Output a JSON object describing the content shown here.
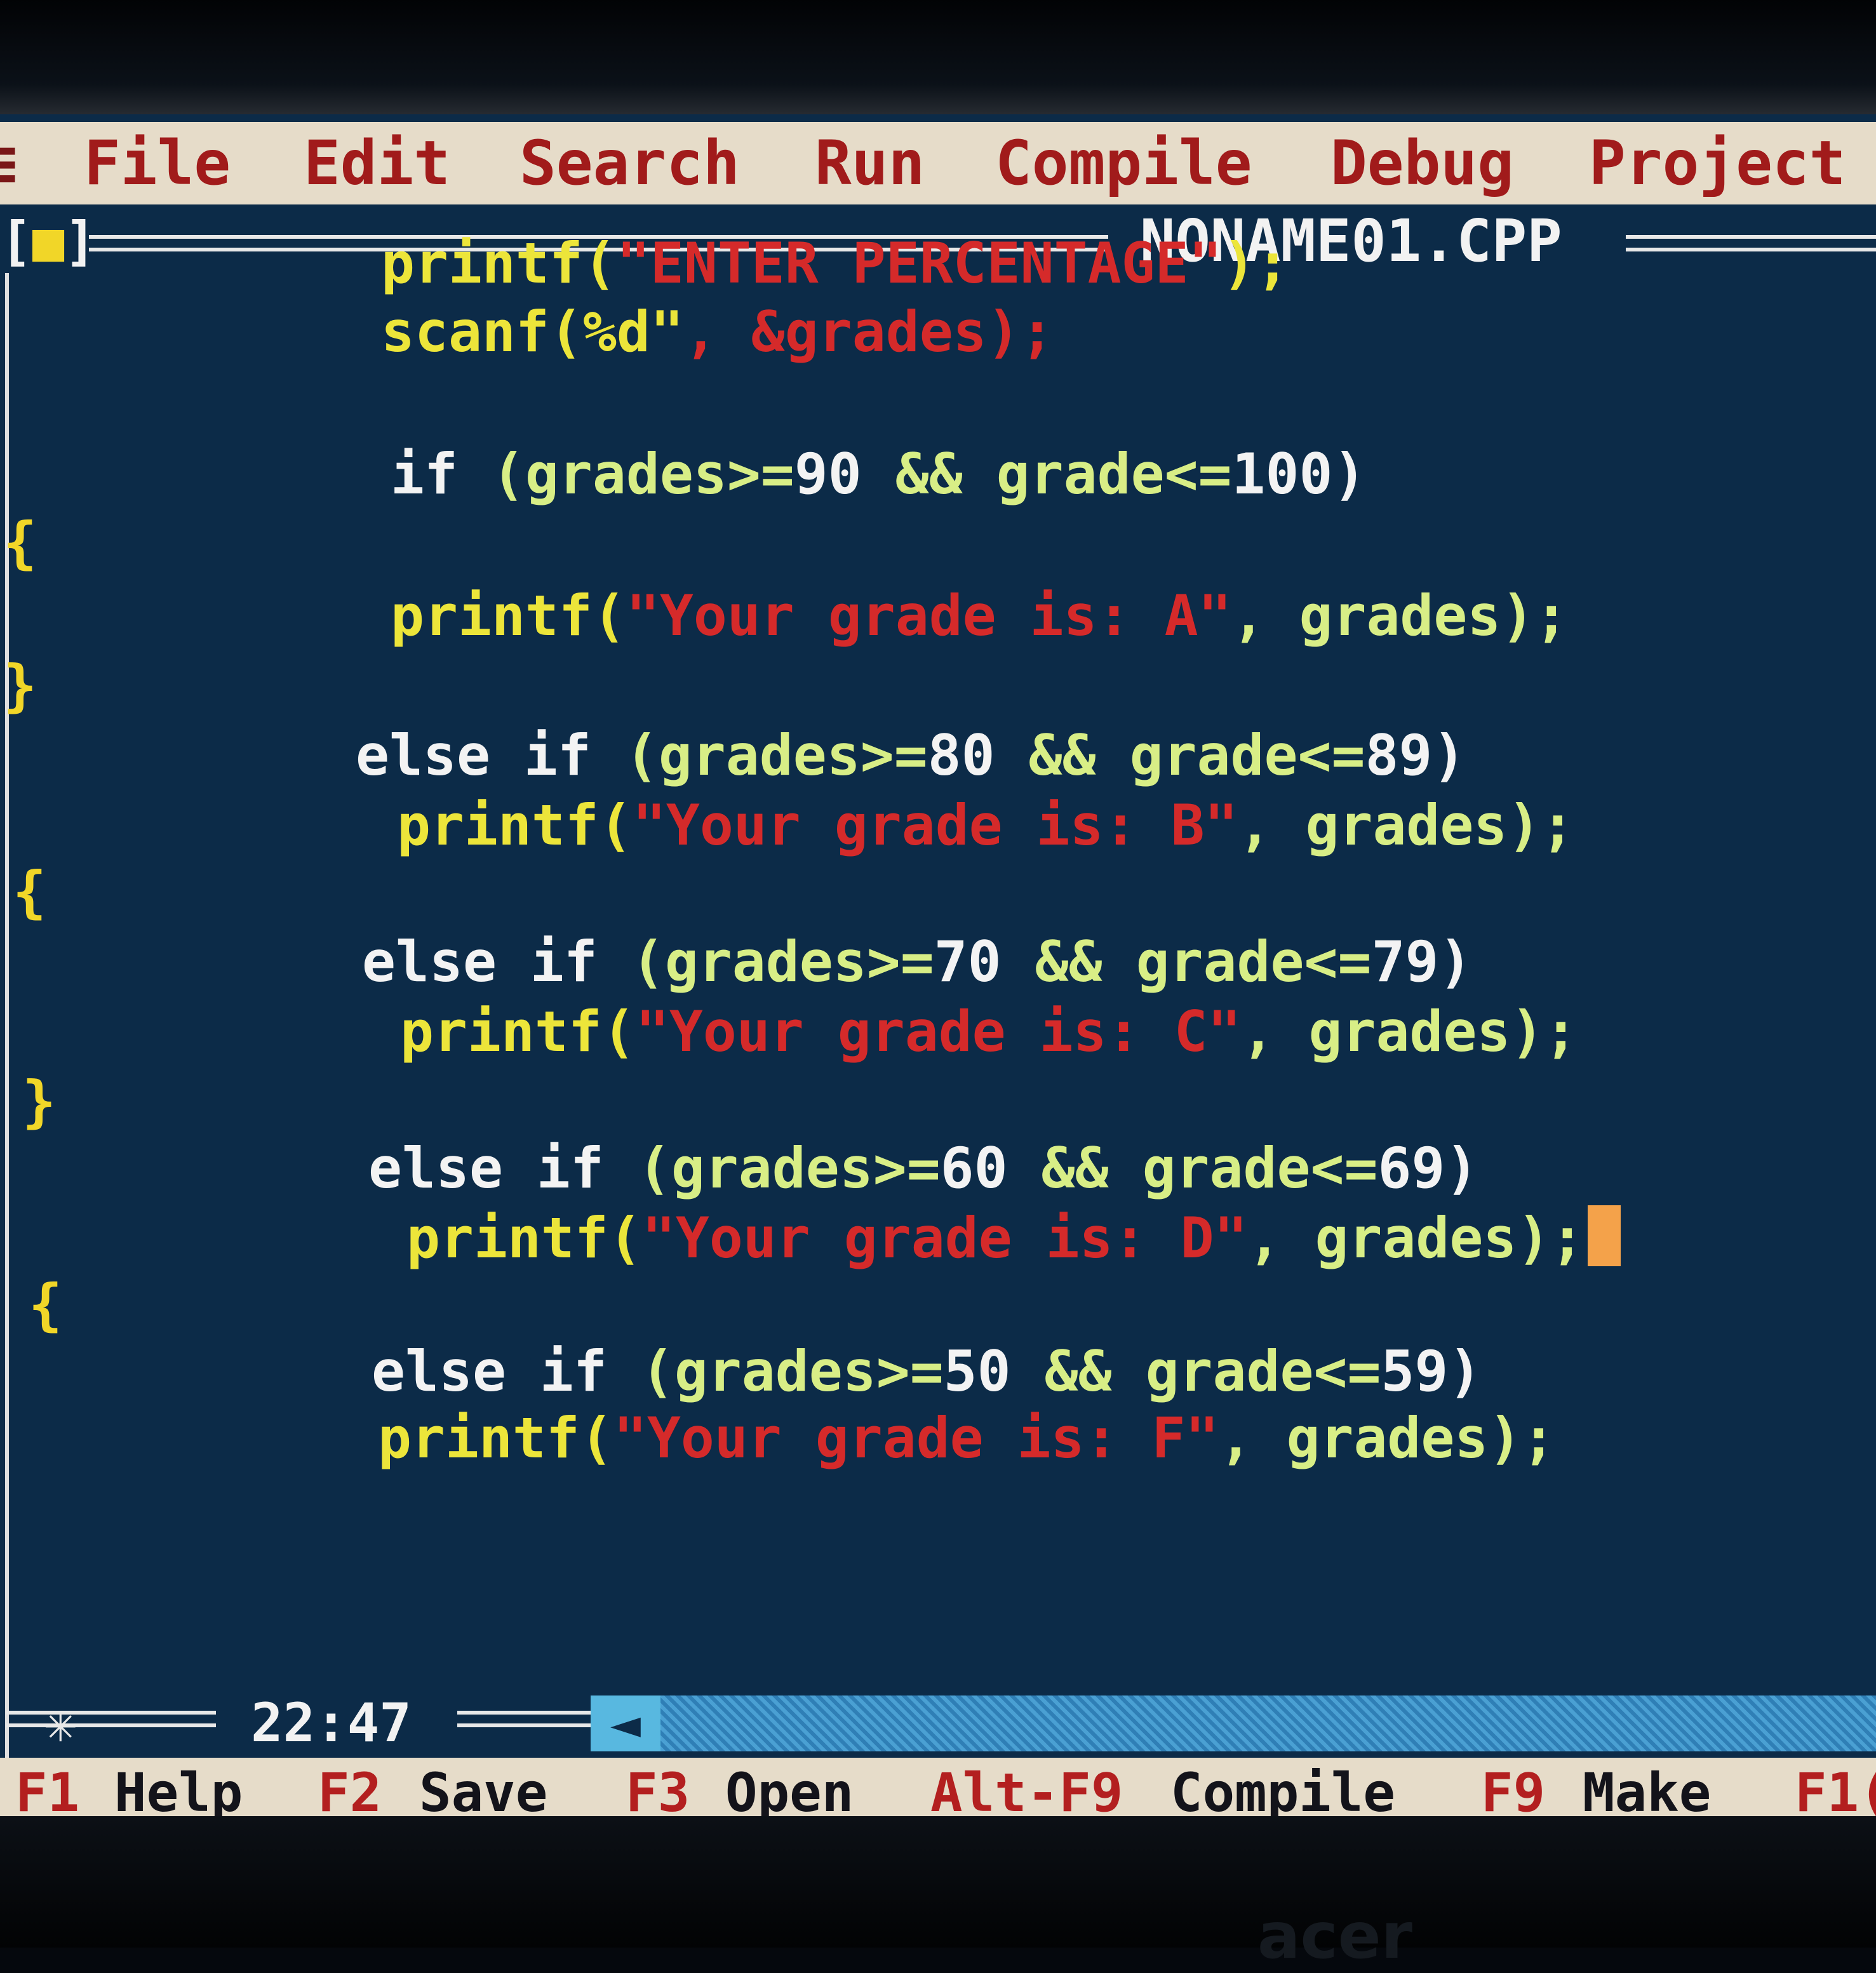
{
  "menu": {
    "system": "≡",
    "file": "File",
    "edit": "Edit",
    "search": "Search",
    "run": "Run",
    "compile": "Compile",
    "debug": "Debug",
    "project": "Project"
  },
  "window": {
    "close_box": "[■]",
    "title": "NONAME01.CPP"
  },
  "code": [
    [
      {
        "t": "printf(",
        "c": "fn"
      },
      {
        "t": "\"ENTER PERCENTAGE\"",
        "c": "st"
      },
      {
        "t": ");",
        "c": "fn"
      }
    ],
    [
      {
        "t": "scanf(%d\"",
        "c": "fn"
      },
      {
        "t": ", &grades);",
        "c": "st"
      }
    ],
    [
      {
        "t": "if ",
        "c": "kw"
      },
      {
        "t": "(grades>=",
        "c": "gr"
      },
      {
        "t": "90 ",
        "c": "kw"
      },
      {
        "t": "&& grade<=",
        "c": "gr"
      },
      {
        "t": "100)",
        "c": "kw"
      }
    ],
    [
      {
        "t": "{",
        "c": "br"
      }
    ],
    [
      {
        "t": "printf(",
        "c": "fn"
      },
      {
        "t": "\"Your grade is: A\"",
        "c": "st"
      },
      {
        "t": ", grades);",
        "c": "gr"
      }
    ],
    [
      {
        "t": "}",
        "c": "br"
      }
    ],
    [
      {
        "t": "else if ",
        "c": "kw"
      },
      {
        "t": "(grades>=",
        "c": "gr"
      },
      {
        "t": "80 ",
        "c": "kw"
      },
      {
        "t": "&& grade<=",
        "c": "gr"
      },
      {
        "t": "89)",
        "c": "kw"
      }
    ],
    [
      {
        "t": "printf(",
        "c": "fn"
      },
      {
        "t": "\"Your grade is: B\"",
        "c": "st"
      },
      {
        "t": ", grades);",
        "c": "gr"
      }
    ],
    [
      {
        "t": "{",
        "c": "br"
      }
    ],
    [
      {
        "t": "else if ",
        "c": "kw"
      },
      {
        "t": "(grades>=",
        "c": "gr"
      },
      {
        "t": "70 ",
        "c": "kw"
      },
      {
        "t": "&& grade<=",
        "c": "gr"
      },
      {
        "t": "79)",
        "c": "kw"
      }
    ],
    [
      {
        "t": "printf(",
        "c": "fn"
      },
      {
        "t": "\"Your grade is: C\"",
        "c": "st"
      },
      {
        "t": ", grades);",
        "c": "gr"
      }
    ],
    [
      {
        "t": "}",
        "c": "br"
      }
    ],
    [
      {
        "t": "else if ",
        "c": "kw"
      },
      {
        "t": "(grades>=",
        "c": "gr"
      },
      {
        "t": "60 ",
        "c": "kw"
      },
      {
        "t": "&& grade<=",
        "c": "gr"
      },
      {
        "t": "69)",
        "c": "kw"
      }
    ],
    [
      {
        "t": "printf(",
        "c": "fn"
      },
      {
        "t": "\"Your grade is: D\"",
        "c": "st"
      },
      {
        "t": ", grades);",
        "c": "gr"
      }
    ],
    [
      {
        "t": "{",
        "c": "br"
      }
    ],
    [
      {
        "t": "else if ",
        "c": "kw"
      },
      {
        "t": "(grades>=",
        "c": "gr"
      },
      {
        "t": "50 ",
        "c": "kw"
      },
      {
        "t": "&& grade<=",
        "c": "gr"
      },
      {
        "t": "59)",
        "c": "kw"
      }
    ],
    [
      {
        "t": "printf(",
        "c": "fn"
      },
      {
        "t": "\"Your grade is: F\"",
        "c": "st"
      },
      {
        "t": ", grades);",
        "c": "gr"
      }
    ]
  ],
  "cursor_line": 13,
  "status": {
    "clock": "22:47",
    "scroll_arrow": "◄"
  },
  "hotkeys": [
    {
      "key": "F1",
      "label": "Help"
    },
    {
      "key": "F2",
      "label": "Save"
    },
    {
      "key": "F3",
      "label": "Open"
    },
    {
      "key": "Alt-F9",
      "label": "Compile"
    },
    {
      "key": "F9",
      "label": "Make"
    },
    {
      "key": "F1(",
      "label": ""
    }
  ],
  "brand": "acer",
  "colors": {
    "editor_bg": "#0c2b48",
    "menu_bg": "#e6dcc9",
    "menu_text": "#a11b1b",
    "cursor": "#f4a24a"
  }
}
